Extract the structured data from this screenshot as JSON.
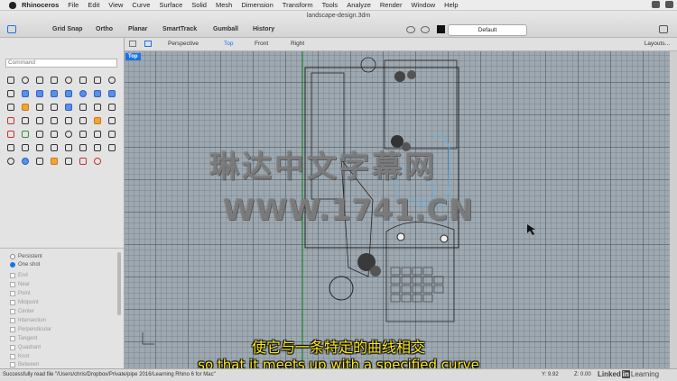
{
  "menubar": {
    "app": "Rhinoceros",
    "items": [
      "File",
      "Edit",
      "View",
      "Curve",
      "Surface",
      "Solid",
      "Mesh",
      "Dimension",
      "Transform",
      "Tools",
      "Analyze",
      "Render",
      "Window",
      "Help"
    ]
  },
  "window": {
    "title": "landscape-design.3dm"
  },
  "toolbar": {
    "items": [
      "Grid Snap",
      "Ortho",
      "Planar",
      "SmartTrack",
      "Gumball",
      "History"
    ],
    "layer": "Default"
  },
  "command": {
    "placeholder": "Command"
  },
  "viewport_tabs": {
    "tabs": [
      "Perspective",
      "Top",
      "Front",
      "Right"
    ],
    "active": "Top",
    "layouts": "Layouts..."
  },
  "viewport": {
    "label": "Top"
  },
  "osnap": {
    "modes": [
      "Persistent",
      "One shot"
    ],
    "items": [
      "End",
      "Near",
      "Point",
      "Midpoint",
      "Center",
      "Intersection",
      "Perpendicular",
      "Tangent",
      "Quadrant",
      "Knot",
      "Between"
    ]
  },
  "watermark": {
    "line1": "琳达中文字幕网",
    "line2": "WWW.1741.CN"
  },
  "subtitle": {
    "cn": "使它与一条特定的曲线相交",
    "en": "so that it meets up with a specified curve"
  },
  "status": {
    "message": "Successfully read file \"/Users/chris/Dropbox/Private/pipe 2016/Learning Rhino 6 for Mac\"",
    "y": "Y: 9.92",
    "z": "Z: 0.00",
    "brand_left": "Linked",
    "brand_in": "in",
    "brand_right": "Learning"
  },
  "colors": {
    "accent": "#1a73e8",
    "subtitle": "#ffeb1a",
    "grid": "#9ea8b0"
  }
}
